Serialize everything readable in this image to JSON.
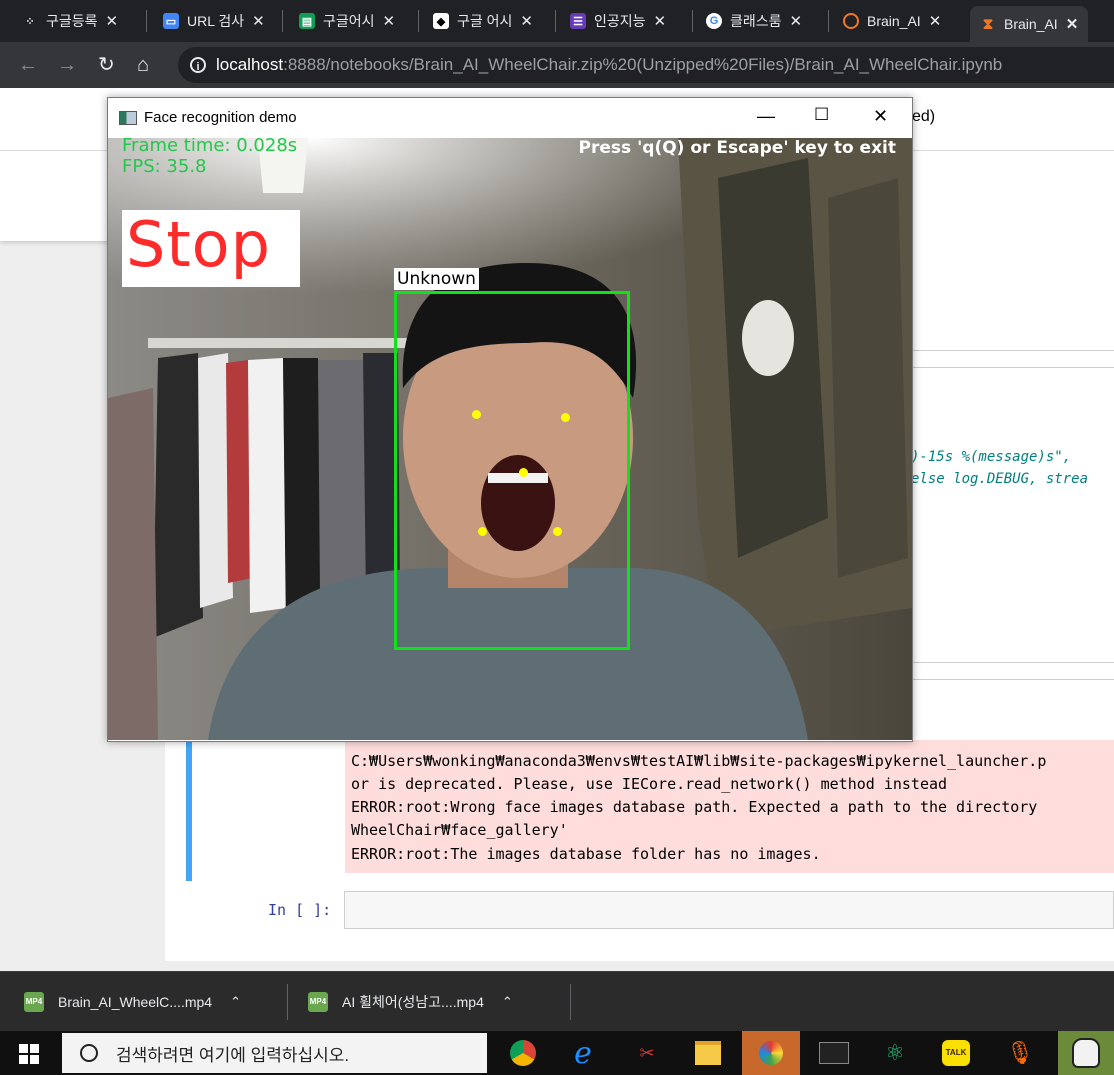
{
  "browser": {
    "tabs": [
      {
        "title": "구글등록",
        "icon": "dots-icon",
        "active": false
      },
      {
        "title": "URL 검사",
        "icon": "url-icon",
        "active": false
      },
      {
        "title": "구글어시",
        "icon": "chat-icon",
        "active": false
      },
      {
        "title": "구글 어시",
        "icon": "github-icon",
        "active": false
      },
      {
        "title": "인공지능",
        "icon": "list-icon",
        "active": false
      },
      {
        "title": "클래스룸",
        "icon": "google-icon",
        "active": false
      },
      {
        "title": "Brain_AI",
        "icon": "loading-icon",
        "active": false
      },
      {
        "title": "Brain_AI",
        "icon": "hourglass-icon",
        "active": true
      }
    ],
    "url_host": "localhost",
    "url_path": ":8888/notebooks/Brain_AI_WheelChair.zip%20(Unzipped%20Files)/Brain_AI_WheelChair.ipynb"
  },
  "notebook": {
    "header_fragment": "ed)",
    "code_fragment_1": ")-15s %(message)s\",",
    "code_fragment_2": "else log.DEBUG, strea",
    "stderr_lines": [
      "C:₩Users₩wonking₩anaconda3₩envs₩testAI₩lib₩site-packages₩ipykernel_launcher.p",
      "or is deprecated. Please, use IECore.read_network() method instead",
      "ERROR:root:Wrong face images database path. Expected a path to the directory",
      "WheelChair₩face_gallery'",
      "ERROR:root:The images database folder has no images."
    ],
    "in_prompt": "In [ ]:"
  },
  "face_window": {
    "title": "Face recognition demo",
    "frame_time": "Frame time: 0.028s",
    "fps": "FPS: 35.8",
    "exit_message": "Press 'q(Q) or Escape' key to exit",
    "status": "Stop",
    "face_label": "Unknown"
  },
  "downloads": [
    {
      "name": "Brain_AI_WheelC....mp4"
    },
    {
      "name": "AI 휠체어(성남고....mp4"
    }
  ],
  "taskbar": {
    "search_placeholder": "검색하려면 여기에 입력하십시오."
  },
  "colors": {
    "osd_green": "#21c84a",
    "stop_red": "#ff2a2a",
    "face_box": "#11e01b",
    "landmark": "#ffff00",
    "cell_selected": "#42a5f5",
    "stderr_bg": "#ffdddd"
  }
}
